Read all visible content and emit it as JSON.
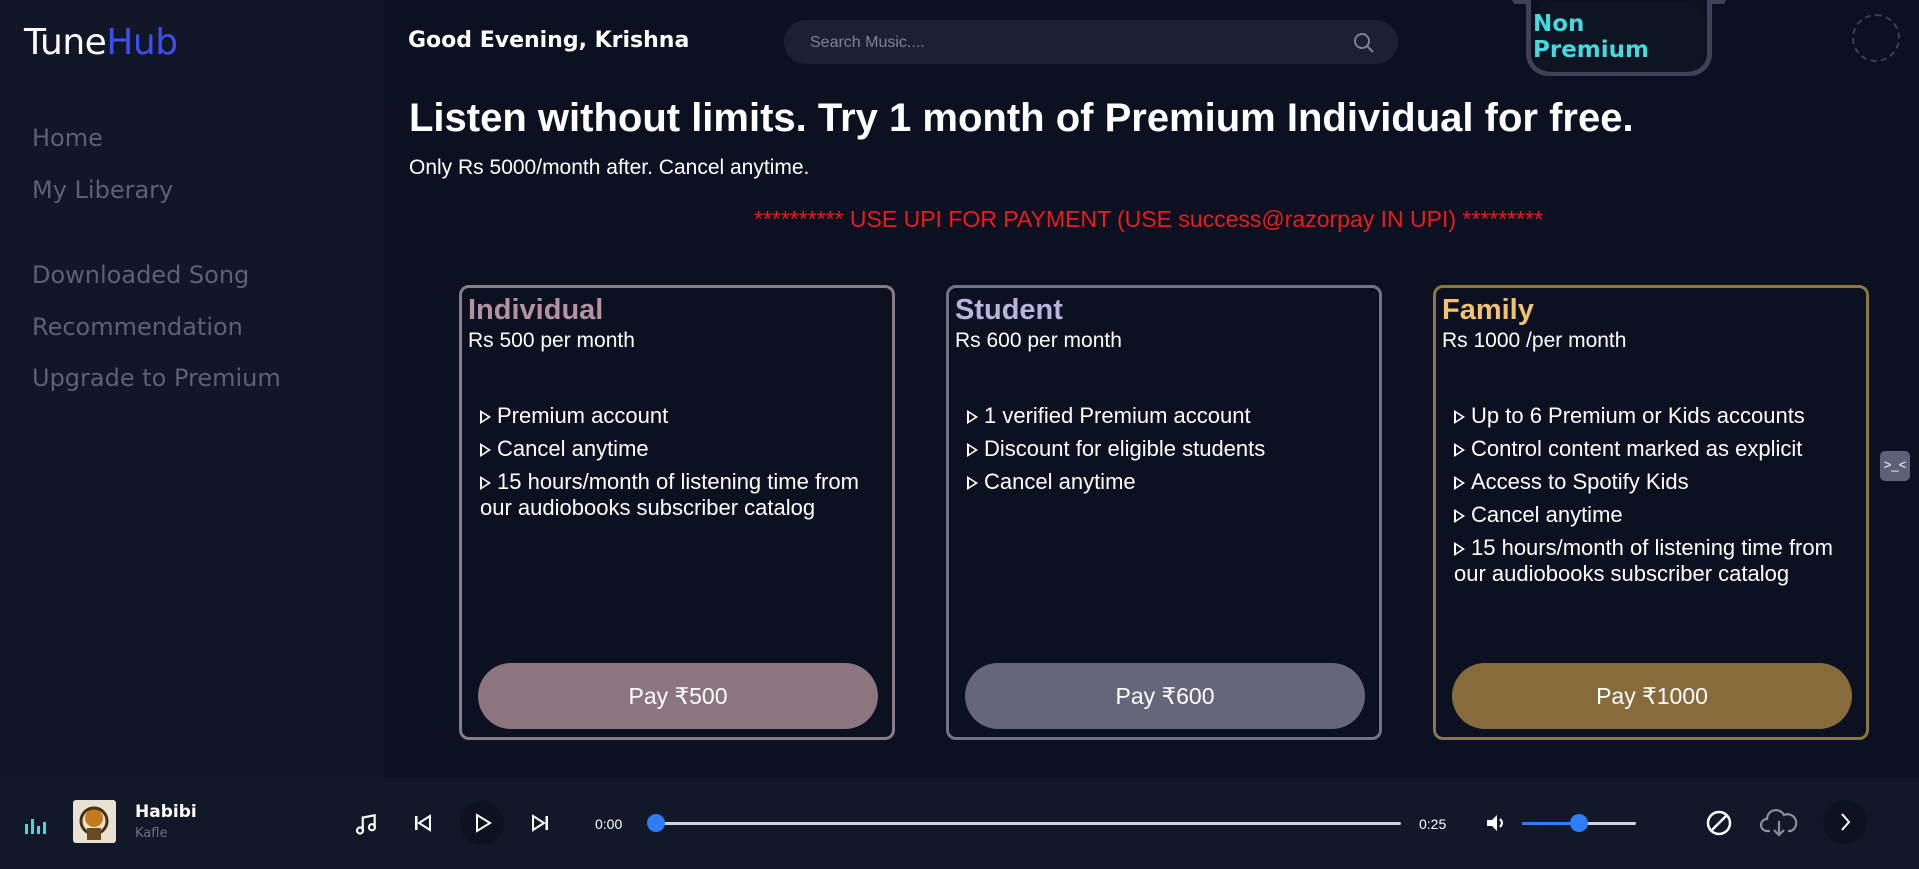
{
  "brand": {
    "part1": "Tune",
    "part2": "Hub"
  },
  "sidebar": {
    "items": [
      {
        "label": "Home"
      },
      {
        "label": "My Liberary"
      },
      {
        "label": "Downloaded Song"
      },
      {
        "label": "Recommendation"
      },
      {
        "label": "Upgrade to Premium"
      }
    ]
  },
  "header": {
    "greeting": "Good Evening, Krishna",
    "search_placeholder": "Search Music....",
    "status_badge": "Non Premium"
  },
  "main": {
    "title": "Listen without limits. Try 1 month of Premium Individual for free.",
    "subtitle": "Only Rs 5000/month after. Cancel anytime.",
    "notice": "********** USE UPI FOR PAYMENT (USE success@razorpay IN UPI) *********"
  },
  "plans": [
    {
      "name": "Individual",
      "price": "Rs 500 per month",
      "features": [
        "Premium account",
        "Cancel anytime",
        "15 hours/month of listening time from our audiobooks subscriber catalog"
      ],
      "button": "Pay ₹500",
      "accent": "#b5929d",
      "border": "#8a7c86",
      "button_color": "#8c757f"
    },
    {
      "name": "Student",
      "price": "Rs 600 per month",
      "features": [
        "1 verified Premium account",
        "Discount for eligible students",
        "Cancel anytime"
      ],
      "button": "Pay ₹600",
      "accent": "#b9b3dd",
      "border": "#717388",
      "button_color": "#666579"
    },
    {
      "name": "Family",
      "price": "Rs 1000 /per month",
      "features": [
        "Up to 6 Premium or Kids accounts",
        "Control content marked as explicit",
        "Access to Spotify Kids",
        "Cancel anytime",
        "15 hours/month of listening time from our audiobooks subscriber catalog"
      ],
      "button": "Pay ₹1000",
      "accent": "#f2c26c",
      "border": "#8a7744",
      "button_color": "#876b3a"
    }
  ],
  "player": {
    "track_title": "Habibi",
    "track_artist": "Kafle",
    "current_time": "0:00",
    "duration": "0:25",
    "progress": 0,
    "volume": 0.5
  },
  "icons": {
    "equalizer": "equalizer-icon",
    "note": "music-note-icon",
    "prev": "previous-icon",
    "play": "play-icon",
    "next": "next-icon",
    "volume": "volume-icon",
    "block": "block-icon",
    "download": "cloud-download-icon",
    "chevron": "chevron-right-icon"
  },
  "colors": {
    "brand": "#3d4ff0",
    "badge": "#44d9df",
    "notice": "#ee1b1b",
    "slider": "#2c7df6"
  }
}
